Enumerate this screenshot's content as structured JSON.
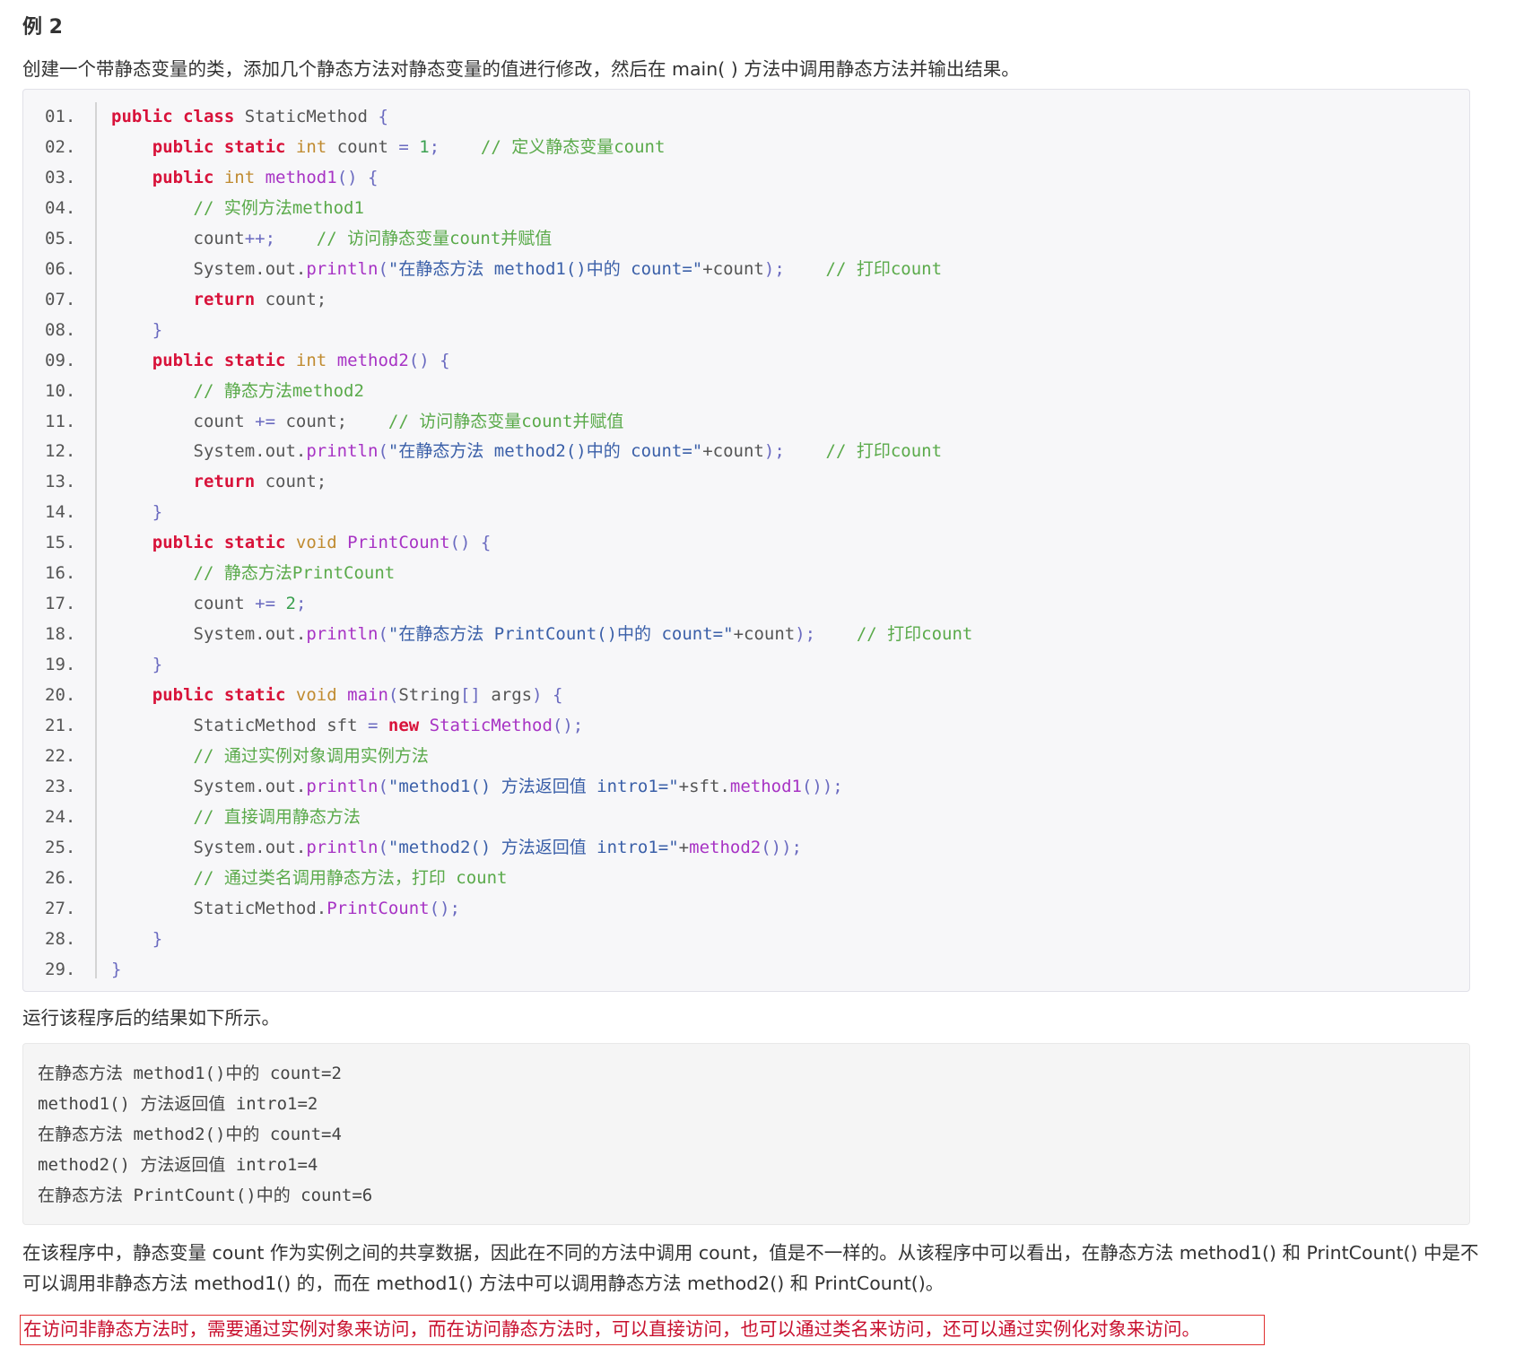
{
  "heading": "例 2",
  "intro": "创建一个带静态变量的类，添加几个静态方法对静态变量的值进行修改，然后在 main( ) 方法中调用静态方法并输出结果。",
  "code": {
    "line_numbers": [
      "01.",
      "02.",
      "03.",
      "04.",
      "05.",
      "06.",
      "07.",
      "08.",
      "09.",
      "10.",
      "11.",
      "12.",
      "13.",
      "14.",
      "15.",
      "16.",
      "17.",
      "18.",
      "19.",
      "20.",
      "21.",
      "22.",
      "23.",
      "24.",
      "25.",
      "26.",
      "27.",
      "28.",
      "29."
    ],
    "lines": [
      [
        [
          "kw",
          "public class "
        ],
        [
          "cls",
          "StaticMethod "
        ],
        [
          "punc",
          "{"
        ]
      ],
      [
        [
          "sp",
          "    "
        ],
        [
          "kw",
          "public static "
        ],
        [
          "type",
          "int "
        ],
        [
          "cls",
          "count "
        ],
        [
          "punc",
          "= "
        ],
        [
          "num",
          "1"
        ],
        [
          "punc",
          ";    "
        ],
        [
          "cmt",
          "// 定义静态变量count"
        ]
      ],
      [
        [
          "sp",
          "    "
        ],
        [
          "kw",
          "public "
        ],
        [
          "type",
          "int "
        ],
        [
          "fn",
          "method1"
        ],
        [
          "punc",
          "() {"
        ]
      ],
      [
        [
          "sp",
          "        "
        ],
        [
          "cmt",
          "// 实例方法method1"
        ]
      ],
      [
        [
          "sp",
          "        "
        ],
        [
          "cls",
          "count"
        ],
        [
          "punc",
          "++;    "
        ],
        [
          "cmt",
          "// 访问静态变量count并赋值"
        ]
      ],
      [
        [
          "sp",
          "        "
        ],
        [
          "cls",
          "System.out."
        ],
        [
          "fn",
          "println"
        ],
        [
          "punc",
          "("
        ],
        [
          "str",
          "\"在静态方法 method1()中的 count=\""
        ],
        [
          "cls",
          "+count"
        ],
        [
          "punc",
          ");    "
        ],
        [
          "cmt",
          "// 打印count"
        ]
      ],
      [
        [
          "sp",
          "        "
        ],
        [
          "kw",
          "return "
        ],
        [
          "cls",
          "count;"
        ]
      ],
      [
        [
          "sp",
          "    "
        ],
        [
          "punc",
          "}"
        ]
      ],
      [
        [
          "sp",
          "    "
        ],
        [
          "kw",
          "public static "
        ],
        [
          "type",
          "int "
        ],
        [
          "fn",
          "method2"
        ],
        [
          "punc",
          "() {"
        ]
      ],
      [
        [
          "sp",
          "        "
        ],
        [
          "cmt",
          "// 静态方法method2"
        ]
      ],
      [
        [
          "sp",
          "        "
        ],
        [
          "cls",
          "count "
        ],
        [
          "punc",
          "+= "
        ],
        [
          "cls",
          "count;    "
        ],
        [
          "cmt",
          "// 访问静态变量count并赋值"
        ]
      ],
      [
        [
          "sp",
          "        "
        ],
        [
          "cls",
          "System.out."
        ],
        [
          "fn",
          "println"
        ],
        [
          "punc",
          "("
        ],
        [
          "str",
          "\"在静态方法 method2()中的 count=\""
        ],
        [
          "cls",
          "+count"
        ],
        [
          "punc",
          ");    "
        ],
        [
          "cmt",
          "// 打印count"
        ]
      ],
      [
        [
          "sp",
          "        "
        ],
        [
          "kw",
          "return "
        ],
        [
          "cls",
          "count;"
        ]
      ],
      [
        [
          "sp",
          "    "
        ],
        [
          "punc",
          "}"
        ]
      ],
      [
        [
          "sp",
          "    "
        ],
        [
          "kw",
          "public static "
        ],
        [
          "type",
          "void "
        ],
        [
          "fn",
          "PrintCount"
        ],
        [
          "punc",
          "() {"
        ]
      ],
      [
        [
          "sp",
          "        "
        ],
        [
          "cmt",
          "// 静态方法PrintCount"
        ]
      ],
      [
        [
          "sp",
          "        "
        ],
        [
          "cls",
          "count "
        ],
        [
          "punc",
          "+= "
        ],
        [
          "num",
          "2"
        ],
        [
          "punc",
          ";"
        ]
      ],
      [
        [
          "sp",
          "        "
        ],
        [
          "cls",
          "System.out."
        ],
        [
          "fn",
          "println"
        ],
        [
          "punc",
          "("
        ],
        [
          "str",
          "\"在静态方法 PrintCount()中的 count=\""
        ],
        [
          "cls",
          "+count"
        ],
        [
          "punc",
          ");    "
        ],
        [
          "cmt",
          "// 打印count"
        ]
      ],
      [
        [
          "sp",
          "    "
        ],
        [
          "punc",
          "}"
        ]
      ],
      [
        [
          "sp",
          "    "
        ],
        [
          "kw",
          "public static "
        ],
        [
          "type",
          "void "
        ],
        [
          "fn",
          "main"
        ],
        [
          "punc",
          "("
        ],
        [
          "cls",
          "String"
        ],
        [
          "punc",
          "[] "
        ],
        [
          "cls",
          "args"
        ],
        [
          "punc",
          ") {"
        ]
      ],
      [
        [
          "sp",
          "        "
        ],
        [
          "cls",
          "StaticMethod sft "
        ],
        [
          "punc",
          "= "
        ],
        [
          "kw",
          "new "
        ],
        [
          "fn",
          "StaticMethod"
        ],
        [
          "punc",
          "();"
        ]
      ],
      [
        [
          "sp",
          "        "
        ],
        [
          "cmt",
          "// 通过实例对象调用实例方法"
        ]
      ],
      [
        [
          "sp",
          "        "
        ],
        [
          "cls",
          "System.out."
        ],
        [
          "fn",
          "println"
        ],
        [
          "punc",
          "("
        ],
        [
          "str",
          "\"method1() 方法返回值 intro1=\""
        ],
        [
          "cls",
          "+sft."
        ],
        [
          "fn",
          "method1"
        ],
        [
          "punc",
          "());"
        ]
      ],
      [
        [
          "sp",
          "        "
        ],
        [
          "cmt",
          "// 直接调用静态方法"
        ]
      ],
      [
        [
          "sp",
          "        "
        ],
        [
          "cls",
          "System.out."
        ],
        [
          "fn",
          "println"
        ],
        [
          "punc",
          "("
        ],
        [
          "str",
          "\"method2() 方法返回值 intro1=\""
        ],
        [
          "cls",
          "+"
        ],
        [
          "fn",
          "method2"
        ],
        [
          "punc",
          "());"
        ]
      ],
      [
        [
          "sp",
          "        "
        ],
        [
          "cmt",
          "// 通过类名调用静态方法，打印 count"
        ]
      ],
      [
        [
          "sp",
          "        "
        ],
        [
          "cls",
          "StaticMethod."
        ],
        [
          "fn",
          "PrintCount"
        ],
        [
          "punc",
          "();"
        ]
      ],
      [
        [
          "sp",
          "    "
        ],
        [
          "punc",
          "}"
        ]
      ],
      [
        [
          "punc",
          "}"
        ]
      ]
    ]
  },
  "result_intro": "运行该程序后的结果如下所示。",
  "output_lines": [
    "在静态方法 method1()中的 count=2",
    "method1() 方法返回值 intro1=2",
    "在静态方法 method2()中的 count=4",
    "method2() 方法返回值 intro1=4",
    "在静态方法 PrintCount()中的 count=6"
  ],
  "summary": "在该程序中，静态变量 count 作为实例之间的共享数据，因此在不同的方法中调用 count，值是不一样的。从该程序中可以看出，在静态方法 method1() 和 PrintCount() 中是不可以调用非静态方法 method1() 的，而在 method1() 方法中可以调用静态方法 method2() 和 PrintCount()。",
  "note": "在访问非静态方法时，需要通过实例对象来访问，而在访问静态方法时，可以直接访问，也可以通过类名来访问，还可以通过实例化对象来访问。"
}
